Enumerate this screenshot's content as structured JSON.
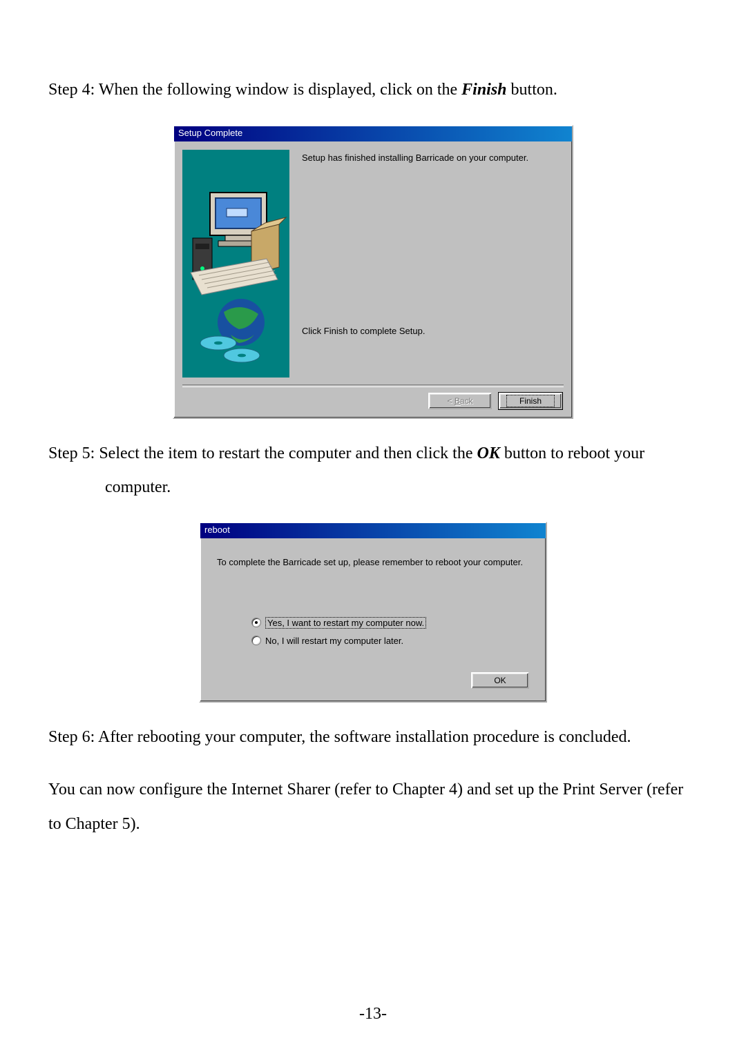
{
  "steps": {
    "step4_prefix": "Step 4: When the following window is displayed, click on the ",
    "step4_bold": "Finish",
    "step4_suffix": " button.",
    "step5_prefix": "Step 5: Select the item to restart the computer and then click the ",
    "step5_bold": "OK",
    "step5_suffix": " button to reboot your",
    "step5_cont": "computer.",
    "step6": "Step 6: After rebooting your computer, the software installation procedure is concluded.",
    "closing": "You can now configure the Internet Sharer (refer to Chapter 4) and set up the Print Server (refer to Chapter 5)."
  },
  "dialog1": {
    "title": "Setup Complete",
    "line1": "Setup has finished installing Barricade on your computer.",
    "line2": "Click Finish to complete Setup.",
    "back_prefix": "< ",
    "back_letter": "B",
    "back_rest": "ack",
    "finish_label": "Finish"
  },
  "dialog2": {
    "title": "reboot",
    "message": "To complete the Barricade set up, please remember to reboot your computer.",
    "opt_yes": "Yes, I want to restart my computer now.",
    "opt_no": "No, I will restart my computer later.",
    "ok_label": "OK"
  },
  "page_number": "-13-"
}
